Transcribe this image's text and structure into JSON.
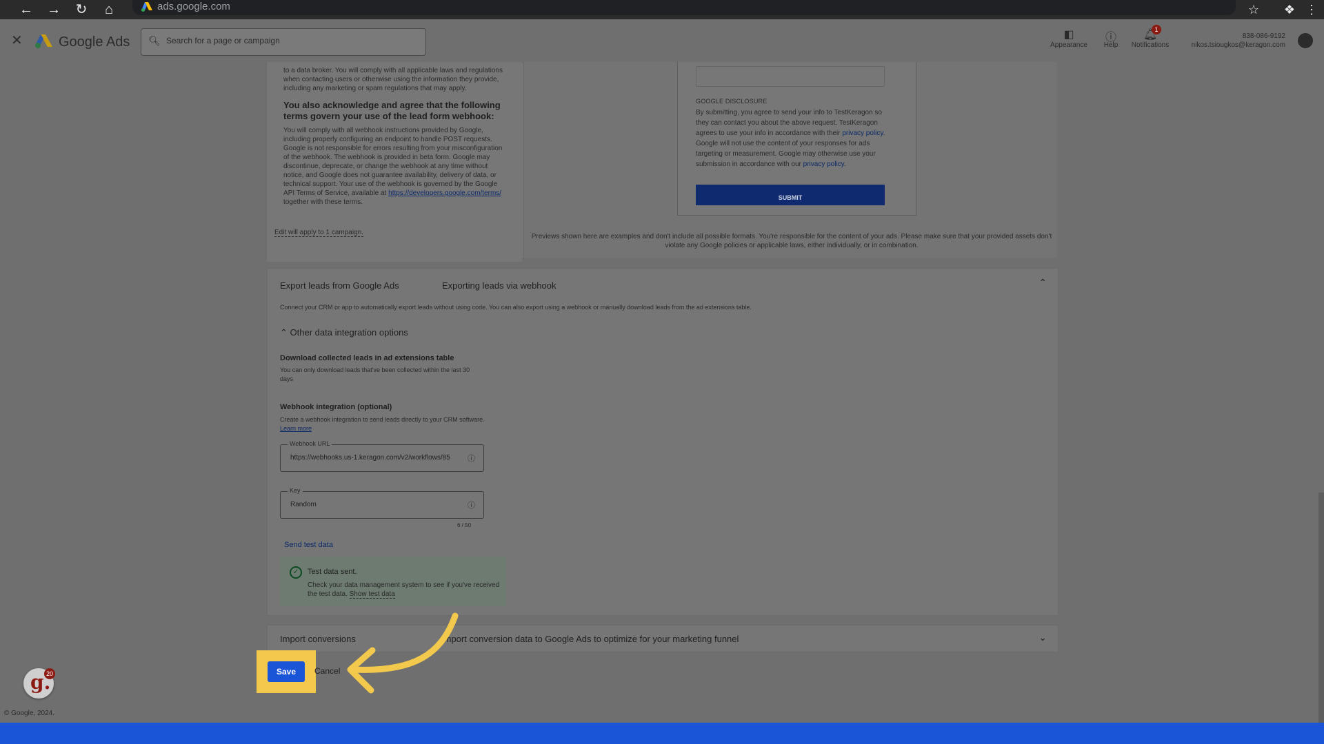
{
  "browser": {
    "url": "ads.google.com",
    "icons": [
      "back-icon",
      "forward-icon",
      "reload-icon",
      "home-icon",
      "star-icon",
      "extensions-icon",
      "more-vert-icon"
    ]
  },
  "header": {
    "brand": "Google Ads",
    "search_placeholder": "Search for a page or campaign",
    "tools": {
      "appearance": "Appearance",
      "help": "Help",
      "notifications": "Notifications",
      "notifications_count": "1"
    },
    "account_id": "838-086-9192",
    "account_email": "nikos.tsiougkos@keragon.com"
  },
  "terms": {
    "para1": "to a data broker. You will comply with all applicable laws and regulations when contacting users or otherwise using the information they provide, including any marketing or spam regulations that may apply.",
    "bold_heading": "You also acknowledge and agree that the following terms govern your use of the lead form webhook:",
    "para2": "You will comply with all webhook instructions provided by Google, including properly configuring an endpoint to handle POST requests. Google is not responsible for errors resulting from your misconfiguration of the webhook. The webhook is provided in beta form. Google may discontinue, deprecate, or change the webhook at any time without notice, and Google does not guarantee availability, delivery of data, or technical support. Your use of the webhook is governed by the Google API Terms of Service, available at",
    "terms_link": "https://developers.google.com/terms/",
    "para2_tail": " together with these terms.",
    "edit_apply": "Edit will apply to 1 campaign."
  },
  "preview": {
    "disclosure_title": "GOOGLE DISCLOSURE",
    "disclosure_a": "By submitting, you agree to send your info to TestKeragon so they can contact you about the above request. TestKeragon agrees to use your info in accordance with their",
    "privacy_link": "privacy policy",
    "disclosure_b": ". Google will not use the content of your responses for ads targeting or measurement. Google may otherwise use your submission in accordance with our",
    "privacy_link_2": "privacy policy",
    "disclosure_c": ".",
    "submit_label": "SUBMIT",
    "note": "Previews shown here are examples and don't include all possible formats. You're responsible for the content of your ads. Please make sure that your provided assets don't violate any Google policies or applicable laws, either individually, or in combination."
  },
  "export": {
    "title": "Export leads from Google Ads",
    "subtitle": "Exporting leads via webhook",
    "description": "Connect your CRM or app to automatically export leads without using code. You can also export using a webhook or manually download leads from the ad extensions table.",
    "other_options": "Other data integration options",
    "download_heading": "Download collected leads in ad extensions table",
    "download_desc": "You can only download leads that've been collected within the last 30 days",
    "webhook_heading": "Webhook integration (optional)",
    "webhook_desc": "Create a webhook integration to send leads directly to your CRM software.",
    "learn_more": "Learn more",
    "webhook_url_label": "Webhook URL",
    "webhook_url_value": "https://webhooks.us-1.keragon.com/v2/workflows/85",
    "key_label": "Key",
    "key_value": "Random",
    "key_counter": "6 / 50",
    "send_test": "Send test data",
    "success_title": "Test data sent.",
    "success_body": "Check your data management system to see if you've received the test data.",
    "show_test_data": "Show test data"
  },
  "import": {
    "title": "Import conversions",
    "subtitle": "Import conversion data to Google Ads to optimize for your marketing funnel"
  },
  "actions": {
    "save": "Save",
    "cancel": "Cancel"
  },
  "extension_badge": {
    "letter": "g.",
    "count": "20"
  },
  "footer": {
    "copyright": "© Google, 2024."
  },
  "colors": {
    "accent_blue": "#1a55d8",
    "highlight_yellow": "#f2c94c",
    "submit_blue": "#0f2a6e"
  }
}
